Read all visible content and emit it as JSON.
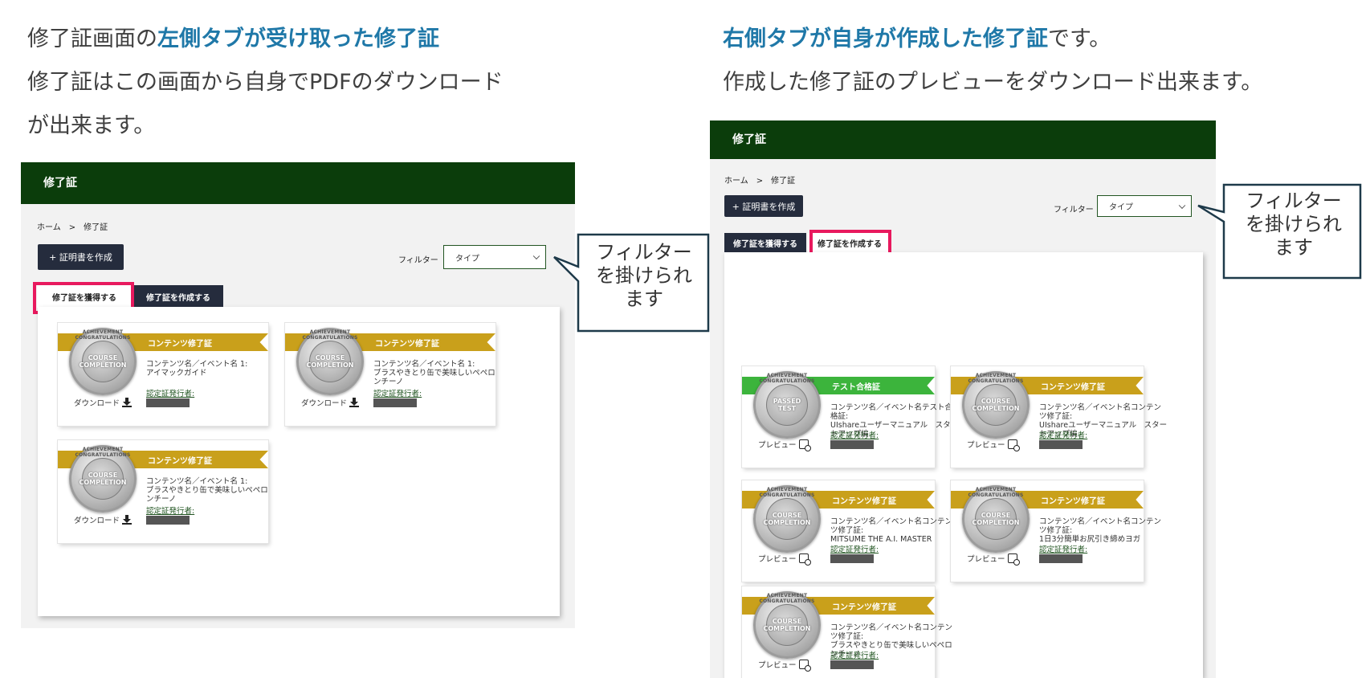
{
  "left_caption": {
    "line1_normal": "修了証画面の",
    "line1_highlight": "左側タブが受け取った修了証",
    "line2": "修了証はこの画面から自身でPDFのダウンロード",
    "line3": "が出来ます。"
  },
  "right_caption": {
    "line1_highlight": "右側タブが自身が作成した修了証",
    "line1_normal": "です。",
    "line2": "作成した修了証のプレビューをダウンロード出来ます。"
  },
  "left_panel": {
    "header_title": "修了証",
    "breadcrumb": {
      "home": "ホーム",
      "sep": ">",
      "current": "修了証"
    },
    "create_button": "+ 証明書を作成",
    "filter_label": "フィルター",
    "filter_value": "タイプ",
    "tabs": {
      "received": "修了証を獲得する",
      "created": "修了証を作成する"
    },
    "active_tab": "received",
    "cards": [
      {
        "ribbon": "コンテンツ修了証",
        "name": "コンテンツ名／イベント名 1:\nアイマックガイド",
        "issuer_label": "認定証発行者:",
        "action": "ダウンロード"
      },
      {
        "ribbon": "コンテンツ修了証",
        "name": "コンテンツ名／イベント名 1:\nブラスやきとり缶で美味しいペペロンチーノ",
        "issuer_label": "認定証発行者:",
        "action": "ダウンロード"
      },
      {
        "ribbon": "コンテンツ修了証",
        "name": "コンテンツ名／イベント名 1:\nブラスやきとり缶で美味しいペペロンチーノ",
        "issuer_label": "認定証発行者:",
        "action": "ダウンロード"
      }
    ]
  },
  "right_panel": {
    "header_title": "修了証",
    "breadcrumb": {
      "home": "ホーム",
      "sep": ">",
      "current": "修了証"
    },
    "create_button": "+ 証明書を作成",
    "filter_label": "フィルター",
    "filter_value": "タイプ",
    "tabs": {
      "received": "修了証を獲得する",
      "created": "修了証を作成する"
    },
    "active_tab": "created",
    "cards": [
      {
        "ribbon": "テスト合格証",
        "ribbon_color": "#3cb43c",
        "badge_text": "PASSED\nTEST",
        "name": "コンテンツ名／イベント名テスト合格証:\nUIshareユーザーマニュアル　スタートアップ編",
        "issuer_label": "認定証発行者:",
        "action": "プレビュー"
      },
      {
        "ribbon": "コンテンツ修了証",
        "ribbon_color": "#c9a01b",
        "badge_text": "COURSE\nCOMPLETION",
        "name": "コンテンツ名／イベント名コンテンツ修了証:\nUIshareユーザーマニュアル　スタートアップ編",
        "issuer_label": "認定証発行者:",
        "action": "プレビュー"
      },
      {
        "ribbon": "コンテンツ修了証",
        "ribbon_color": "#c9a01b",
        "badge_text": "COURSE\nCOMPLETION",
        "name": "コンテンツ名／イベント名コンテンツ修了証:\nMITSUME THE A.I. MASTER",
        "issuer_label": "認定証発行者:",
        "action": "プレビュー"
      },
      {
        "ribbon": "コンテンツ修了証",
        "ribbon_color": "#c9a01b",
        "badge_text": "COURSE\nCOMPLETION",
        "name": "コンテンツ名／イベント名コンテンツ修了証:\n1日3分簡単お尻引き締めヨガ",
        "issuer_label": "認定証発行者:",
        "action": "プレビュー"
      },
      {
        "ribbon": "コンテンツ修了証",
        "ribbon_color": "#c9a01b",
        "badge_text": "COURSE\nCOMPLETION",
        "name": "コンテンツ名／イベント名コンテンツ修了証:\nブラスやきとり缶で美味しいペペロンチーノ",
        "issuer_label": "認定証発行者:",
        "action": "プレビュー"
      }
    ]
  },
  "badge": {
    "ring_text": "ACHIEVEMENT CONGRATULATIONS",
    "course_text": "COURSE\nCOMPLETION"
  },
  "callout_left": {
    "text": "フィルター\nを掛けられ\nます"
  },
  "callout_right": {
    "text": "フィルター\nを掛けられ\nます"
  },
  "colors": {
    "header": "#0b3d0b",
    "highlight": "#1f78a8",
    "pink": "#e8195e",
    "button": "#252c3d",
    "gold": "#c9a01b",
    "green": "#3cb43c"
  }
}
